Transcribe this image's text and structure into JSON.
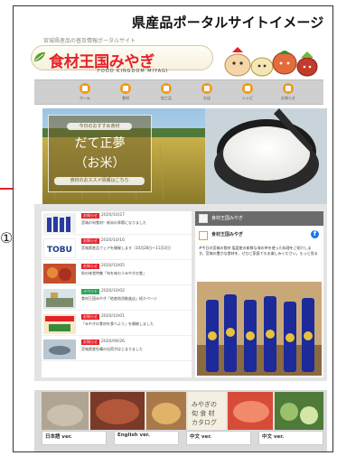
{
  "caption": "県産品ポータルサイトイメージ",
  "side_bracket": "①)",
  "site": {
    "subtitle": "宮城県産品の普及情報ポータルサイト",
    "logo_text": "食材王国みやぎ",
    "logo_en": "FOOD KINGDOM MIYAGI"
  },
  "nav": {
    "items": [
      {
        "label": "ホーム",
        "icon": "home-icon"
      },
      {
        "label": "食材",
        "icon": "food-icon"
      },
      {
        "label": "加工品",
        "icon": "processed-icon"
      },
      {
        "label": "お店",
        "icon": "shop-icon"
      },
      {
        "label": "レシピ",
        "icon": "recipe-icon"
      },
      {
        "label": "お知らせ",
        "icon": "info-icon"
      }
    ]
  },
  "hero": {
    "tag": "今日のおすすめ食材",
    "title": "だて正夢",
    "subtitle": "（お米）",
    "link": "食材のおススメ情報はこちら"
  },
  "news": [
    {
      "badge": "お知らせ",
      "date": "2020/10/27",
      "text": "宮城の旬食材！新米の季節になりました",
      "thumb": "bottles"
    },
    {
      "badge": "お知らせ",
      "date": "2020/10/16",
      "text": "宮城県産品フェアを開催します（10月28日〜11月3日）",
      "thumb": "tobu"
    },
    {
      "badge": "お知らせ",
      "date": "2020/10/05",
      "text": "秋の味覚特集「旬を味わうみやぎの食」",
      "thumb": "autumn"
    },
    {
      "badge": "イベント",
      "date": "2020/10/02",
      "text": "食材王国みやぎ「地産地消推進店」紹介ページ",
      "thumb": "market"
    },
    {
      "badge": "お知らせ",
      "date": "2020/10/01",
      "text": "「みやぎの食材を食べよう」を開催しました",
      "thumb": "poster"
    },
    {
      "badge": "お知らせ",
      "date": "2020/09/26",
      "text": "宮城県産牡蠣の出荷がはじまりました",
      "thumb": "fish"
    }
  ],
  "facebook": {
    "page_name": "食材王国みやぎ",
    "post_name": "食材王国みやぎ",
    "post_time": "",
    "post_text": "#今日の宮城の食材 塩釜産の新鮮な海の幸を使った料理をご紹介します。宮城の豊かな食材を、ぜひご家庭でもお楽しみください。もっと見る"
  },
  "languages": [
    {
      "title": "日本語 ver.",
      "sub": ""
    },
    {
      "title": "English ver.",
      "sub": ""
    },
    {
      "title": "中文 ver.",
      "sub": ""
    },
    {
      "title": "中文 ver.",
      "sub": ""
    }
  ]
}
